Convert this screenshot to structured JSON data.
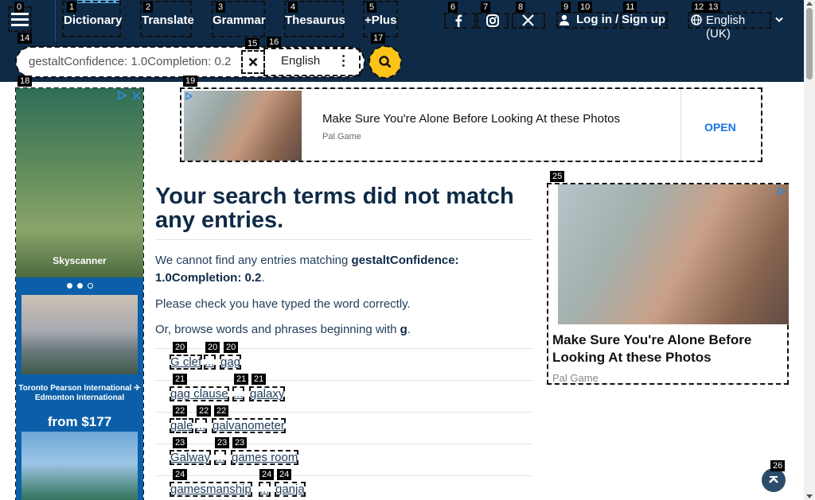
{
  "nav": {
    "dictionary": "Dictionary",
    "translate": "Translate",
    "grammar": "Grammar",
    "thesaurus": "Thesaurus",
    "plus": "+Plus",
    "login": "Log in",
    "slash": "/",
    "signup": "Sign up",
    "language": "English (UK)"
  },
  "search": {
    "value": "gestaltConfidence: 1.0Completion: 0.2",
    "dictionary_select": "English"
  },
  "left_ad": {
    "brand": "Skyscanner",
    "route": "Toronto Pearson International ✈ Edmonton International",
    "price": "from $177"
  },
  "banner_ad": {
    "title": "Make Sure You're Alone Before Looking At these Photos",
    "source": "Pal Game",
    "cta": "OPEN"
  },
  "right_ad": {
    "title": "Make Sure You're Alone Before Looking At these Photos",
    "source": "Pal Game"
  },
  "main": {
    "heading": "Your search terms did not match any entries.",
    "p1_prefix": "We cannot find any entries matching ",
    "p1_term": "gestaltConfidence: 1.0Completion: 0.2",
    "p1_suffix": ".",
    "p2": "Please check you have typed the word correctly.",
    "p3_prefix": "Or, browse words and phrases beginning with ",
    "p3_letter": "g",
    "p3_suffix": "."
  },
  "browse": [
    {
      "first": "G clef",
      "ellipsis": "...",
      "last": "gag"
    },
    {
      "first": "gag clause",
      "ellipsis": "...",
      "last": "galaxy"
    },
    {
      "first": "gale",
      "ellipsis": "...",
      "last": "galvanometer"
    },
    {
      "first": "Galway",
      "ellipsis": "...",
      "last": "games room"
    },
    {
      "first": "gamesmanship",
      "ellipsis": "...",
      "last": "ganja"
    }
  ],
  "marks": {
    "m0": "0",
    "m1": "1",
    "m2": "2",
    "m3": "3",
    "m4": "4",
    "m5": "5",
    "m6": "6",
    "m7": "7",
    "m8": "8",
    "m9": "9",
    "m10": "10",
    "m11": "11",
    "m12": "12",
    "m13": "13",
    "m14": "14",
    "m15": "15",
    "m16": "16",
    "m17": "17",
    "m18": "18",
    "m19": "19",
    "m20": "20",
    "m21": "21",
    "m22": "22",
    "m23": "23",
    "m24": "24",
    "m25": "25",
    "m26": "26"
  },
  "colors": {
    "header_bg": "#0e2a47",
    "accent": "#fcc419",
    "active_tab": "#5ab1e6",
    "text": "#1f3c5a"
  }
}
